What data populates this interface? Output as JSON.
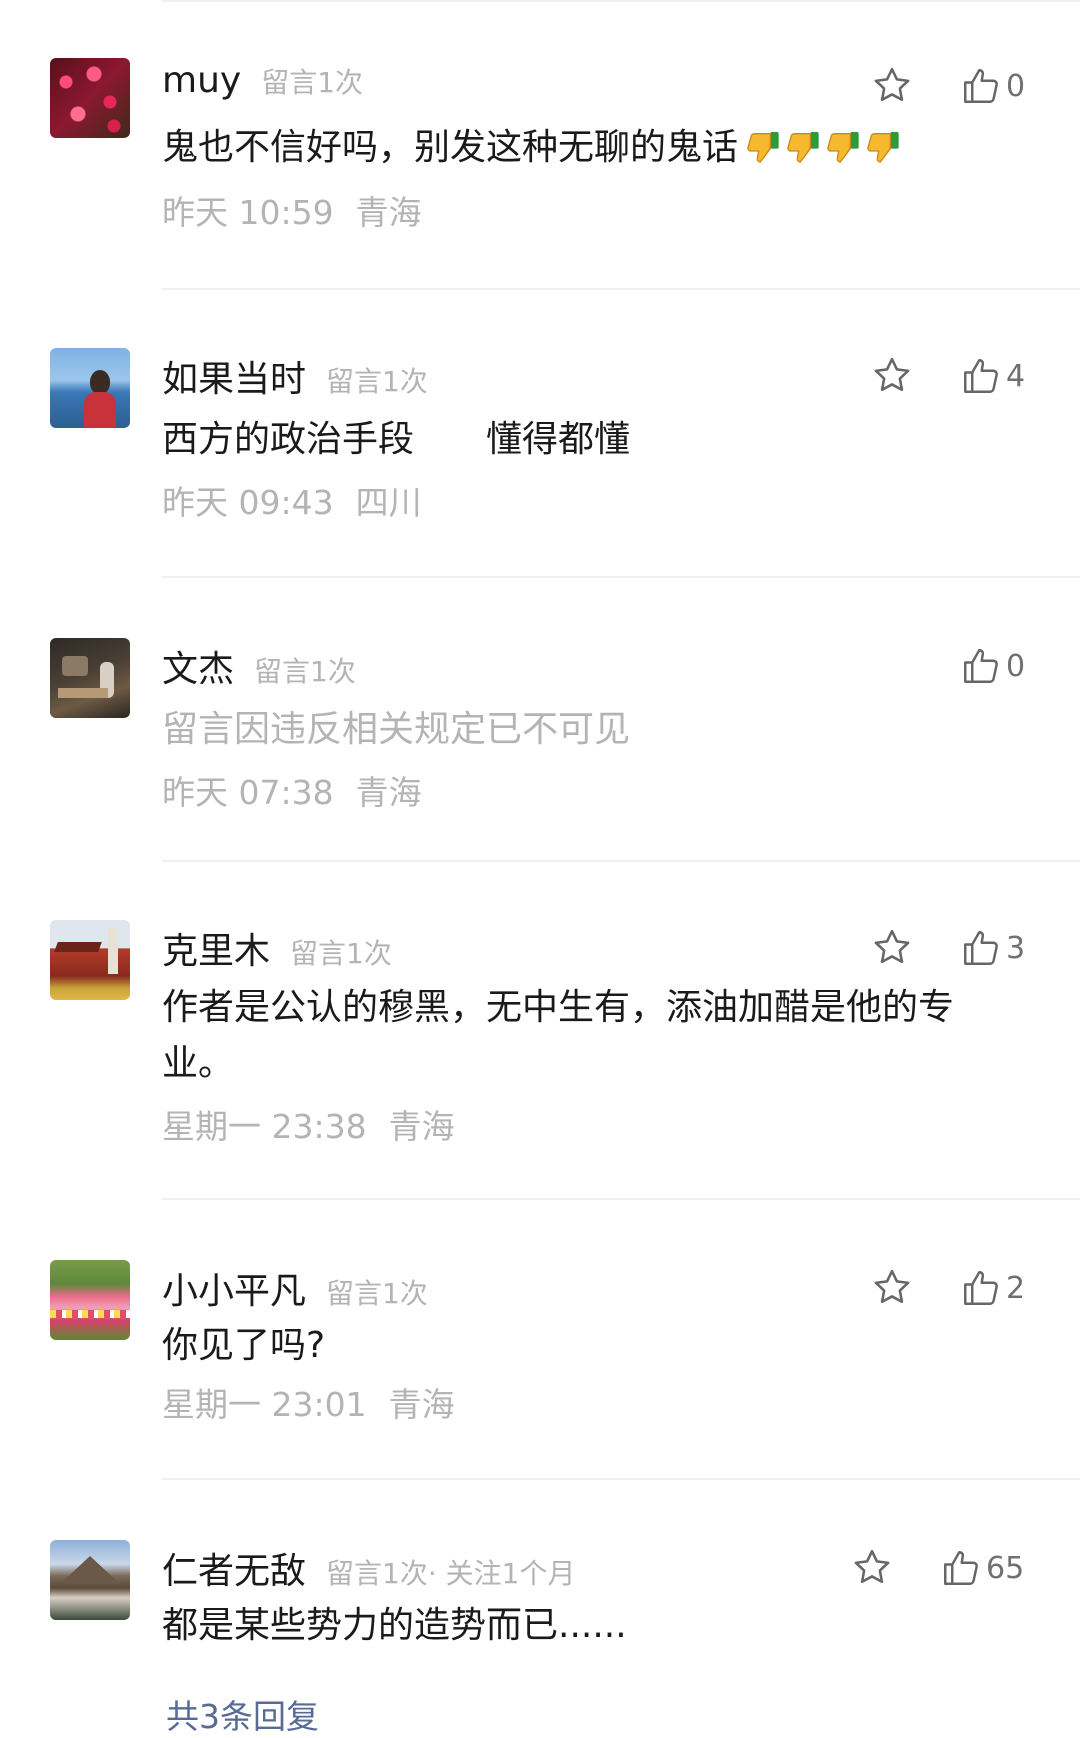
{
  "comments": [
    {
      "name": "muy",
      "tag": "留言1次",
      "extra": "",
      "text": "鬼也不信好吗，别发这种无聊的鬼话",
      "emoji_icon": "thumbs-down-icon",
      "emoji_count": 4,
      "time": "昨天 10:59",
      "location": "青海",
      "likes": "0",
      "removed": false
    },
    {
      "name": "如果当时",
      "tag": "留言1次",
      "extra": "",
      "text": "西方的政治手段　　懂得都懂",
      "time": "昨天 09:43",
      "location": "四川",
      "likes": "4",
      "removed": false
    },
    {
      "name": "文杰",
      "tag": "留言1次",
      "extra": "",
      "text": "留言因违反相关规定已不可见",
      "time": "昨天 07:38",
      "location": "青海",
      "likes": "0",
      "removed": true
    },
    {
      "name": "克里木",
      "tag": "留言1次",
      "extra": "",
      "text": "作者是公认的穆黑，无中生有，添油加醋是他的专业。",
      "time": "星期一 23:38",
      "location": "青海",
      "likes": "3",
      "removed": false
    },
    {
      "name": "小小平凡",
      "tag": "留言1次",
      "extra": "",
      "text": "你见了吗?",
      "time": "星期一 23:01",
      "location": "青海",
      "likes": "2",
      "removed": false
    },
    {
      "name": "仁者无敌",
      "tag": "留言1次",
      "extra": " · 关注1个月",
      "text": "都是某些势力的造势而已......",
      "time": "",
      "location": "",
      "likes": "65",
      "removed": false
    }
  ],
  "replies_label": "共3条回复",
  "colors": {
    "link": "#576b95",
    "muted": "#b4b4b4",
    "icon": "#666666"
  }
}
